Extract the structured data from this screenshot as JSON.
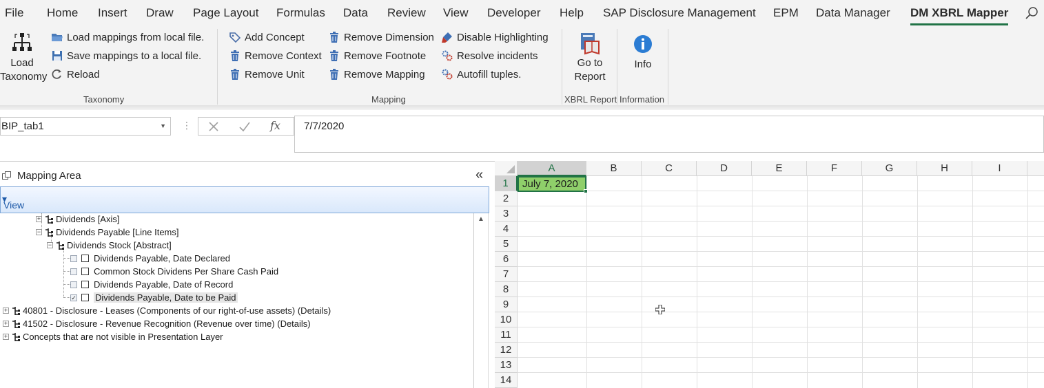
{
  "ribbon_tabs": [
    {
      "label": "File",
      "active": false
    },
    {
      "label": "Home",
      "active": false
    },
    {
      "label": "Insert",
      "active": false
    },
    {
      "label": "Draw",
      "active": false
    },
    {
      "label": "Page Layout",
      "active": false
    },
    {
      "label": "Formulas",
      "active": false
    },
    {
      "label": "Data",
      "active": false
    },
    {
      "label": "Review",
      "active": false
    },
    {
      "label": "View",
      "active": false
    },
    {
      "label": "Developer",
      "active": false
    },
    {
      "label": "Help",
      "active": false
    },
    {
      "label": "SAP Disclosure Management",
      "active": false
    },
    {
      "label": "EPM",
      "active": false
    },
    {
      "label": "Data Manager",
      "active": false
    },
    {
      "label": "DM XBRL Mapper",
      "active": true
    }
  ],
  "ribbon": {
    "taxonomy": {
      "load_taxonomy": "Load\nTaxonomy",
      "load_taxonomy_line1": "Load",
      "load_taxonomy_line2": "Taxonomy",
      "load_mappings": "Load mappings from local file.",
      "save_mappings": "Save mappings to a local file.",
      "reload": "Reload",
      "group_label": "Taxonomy"
    },
    "mapping": {
      "add_concept": "Add Concept",
      "remove_context": "Remove Context",
      "remove_unit": "Remove Unit",
      "remove_dimension": "Remove Dimension",
      "remove_footnote": "Remove Footnote",
      "remove_mapping": "Remove Mapping",
      "disable_highlighting": "Disable Highlighting",
      "resolve_incidents": "Resolve incidents",
      "autofill_tuples": "Autofill tuples.",
      "group_label": "Mapping"
    },
    "xbrl_report": {
      "go_to_report_line1": "Go to",
      "go_to_report_line2": "Report",
      "group_label": "XBRL Report"
    },
    "information": {
      "info": "Info",
      "group_label": "Information"
    }
  },
  "formula_bar": {
    "name_box": "BIP_tab1",
    "formula_value": "7/7/2020",
    "fx_label": "fx"
  },
  "mapping_pane": {
    "title": "Mapping Area",
    "view_menu": "View",
    "tree": [
      {
        "label": "Dividends [Axis]",
        "level": 3,
        "expander": "+",
        "checkbox": false
      },
      {
        "label": "Dividends Payable [Line Items]",
        "level": 3,
        "expander": "−",
        "checkbox": false
      },
      {
        "label": "Dividends Stock [Abstract]",
        "level": 4,
        "expander": "−",
        "checkbox": false
      },
      {
        "label": "Dividends Payable, Date Declared",
        "level": 5,
        "expander": "",
        "checkbox": true,
        "checked": false
      },
      {
        "label": "Common Stock Dividens Per Share Cash Paid",
        "level": 5,
        "expander": "",
        "checkbox": true,
        "checked": false
      },
      {
        "label": "Dividends Payable, Date of Record",
        "level": 5,
        "expander": "",
        "checkbox": true,
        "checked": false
      },
      {
        "label": "Dividends Payable, Date to be Paid",
        "level": 5,
        "expander": "",
        "checkbox": true,
        "checked": true,
        "selected": true
      },
      {
        "label": "40801 - Disclosure - Leases (Components of our right-of-use assets) (Details)",
        "level": 1,
        "expander": "+",
        "checkbox": false
      },
      {
        "label": "41502 - Disclosure - Revenue Recognition (Revenue over time) (Details)",
        "level": 1,
        "expander": "+",
        "checkbox": false
      },
      {
        "label": "Concepts that are not visible in Presentation Layer",
        "level": 1,
        "expander": "+",
        "checkbox": false
      }
    ]
  },
  "sheet": {
    "columns": [
      "A",
      "B",
      "C",
      "D",
      "E",
      "F",
      "G",
      "H",
      "I"
    ],
    "selected_column": "A",
    "rows": [
      "1",
      "2",
      "3",
      "4",
      "5",
      "6",
      "7",
      "8",
      "9",
      "10",
      "11",
      "12",
      "13",
      "14"
    ],
    "selected_row": "1",
    "cell_a1": "July 7, 2020"
  },
  "colors": {
    "excel_green": "#217346",
    "cell_highlight": "#8fcf6a",
    "view_bar_text": "#1e5aa8"
  }
}
